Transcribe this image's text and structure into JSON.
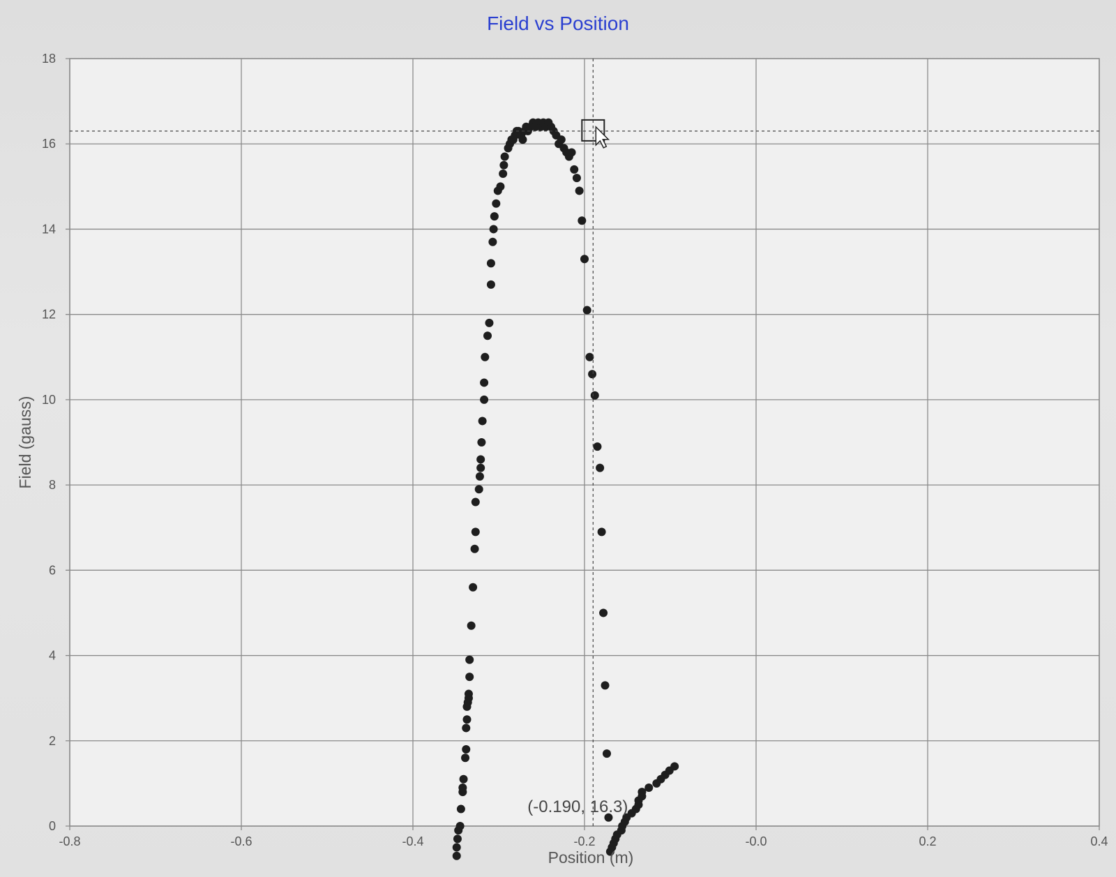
{
  "window": {
    "title": "Field vs Position"
  },
  "chart_data": {
    "type": "scatter",
    "title": "Field vs Position",
    "xlabel": "Position (m)",
    "ylabel": "Field (gauss)",
    "xlim": [
      -0.8,
      0.4
    ],
    "ylim": [
      0,
      18
    ],
    "x_ticks": [
      -0.8,
      -0.6,
      -0.4,
      -0.2,
      0.0,
      0.2,
      0.4
    ],
    "x_tick_labels": [
      "-0.8",
      "-0.6",
      "-0.4",
      "-0.2",
      "-0.0",
      "0.2",
      "0.4"
    ],
    "y_ticks": [
      0,
      2,
      4,
      6,
      8,
      10,
      12,
      14,
      16,
      18
    ],
    "y_tick_labels": [
      "0",
      "2",
      "4",
      "6",
      "8",
      "10",
      "12",
      "14",
      "16",
      "18"
    ],
    "grid": true,
    "marker_color": "#1e1e1e",
    "cursor": {
      "x": -0.19,
      "y": 16.3,
      "readout": "(-0.190, 16.3)"
    },
    "series": [
      {
        "x": [
          -0.349,
          -0.349,
          -0.348,
          -0.347,
          -0.345,
          -0.344,
          -0.342,
          -0.342,
          -0.341,
          -0.339,
          -0.338,
          -0.338,
          -0.337,
          -0.337,
          -0.336,
          -0.335,
          -0.335,
          -0.334,
          -0.334,
          -0.332,
          -0.33,
          -0.328,
          -0.327,
          -0.327,
          -0.323,
          -0.322,
          -0.321,
          -0.321,
          -0.32,
          -0.319,
          -0.317,
          -0.317,
          -0.316,
          -0.313,
          -0.311,
          -0.309,
          -0.309,
          -0.307,
          -0.306,
          -0.305,
          -0.303,
          -0.301,
          -0.298,
          -0.295,
          -0.294,
          -0.293,
          -0.289,
          -0.287,
          -0.285,
          -0.283,
          -0.281,
          -0.279,
          -0.277,
          -0.274,
          -0.272,
          -0.27,
          -0.268,
          -0.266,
          -0.263,
          -0.26,
          -0.257,
          -0.254,
          -0.251,
          -0.248,
          -0.245,
          -0.242,
          -0.239,
          -0.236,
          -0.233,
          -0.23,
          -0.227,
          -0.224,
          -0.221,
          -0.218,
          -0.215,
          -0.212,
          -0.209,
          -0.206,
          -0.203,
          -0.2,
          -0.197,
          -0.194,
          -0.191,
          -0.188,
          -0.185,
          -0.182,
          -0.18,
          -0.178,
          -0.176,
          -0.174,
          -0.172,
          -0.17,
          -0.168,
          -0.166,
          -0.164,
          -0.162,
          -0.157,
          -0.156,
          -0.153,
          -0.151,
          -0.145,
          -0.14,
          -0.137,
          -0.137,
          -0.133,
          -0.133,
          -0.125,
          -0.116,
          -0.111,
          -0.106,
          -0.101,
          -0.095
        ],
        "y": [
          -0.7,
          -0.5,
          -0.3,
          -0.1,
          0.0,
          0.4,
          0.8,
          0.9,
          1.1,
          1.6,
          1.8,
          2.3,
          2.5,
          2.8,
          2.9,
          3.0,
          3.1,
          3.5,
          3.9,
          4.7,
          5.6,
          6.5,
          6.9,
          7.6,
          7.9,
          8.2,
          8.4,
          8.6,
          9.0,
          9.5,
          10.0,
          10.4,
          11.0,
          11.5,
          11.8,
          12.7,
          13.2,
          13.7,
          14.0,
          14.3,
          14.6,
          14.9,
          15.0,
          15.3,
          15.5,
          15.7,
          15.9,
          16.0,
          16.1,
          16.1,
          16.2,
          16.3,
          16.3,
          16.2,
          16.1,
          16.3,
          16.4,
          16.3,
          16.4,
          16.5,
          16.4,
          16.5,
          16.4,
          16.5,
          16.4,
          16.5,
          16.4,
          16.3,
          16.2,
          16.0,
          16.1,
          15.9,
          15.8,
          15.7,
          15.8,
          15.4,
          15.2,
          14.9,
          14.2,
          13.3,
          12.1,
          11.0,
          10.6,
          10.1,
          8.9,
          8.4,
          6.9,
          5.0,
          3.3,
          1.7,
          0.2,
          -0.6,
          -0.5,
          -0.4,
          -0.3,
          -0.2,
          -0.1,
          0.0,
          0.1,
          0.2,
          0.3,
          0.4,
          0.5,
          0.6,
          0.7,
          0.8,
          0.9,
          1.0,
          1.1,
          1.2,
          1.3,
          1.4
        ]
      }
    ]
  }
}
